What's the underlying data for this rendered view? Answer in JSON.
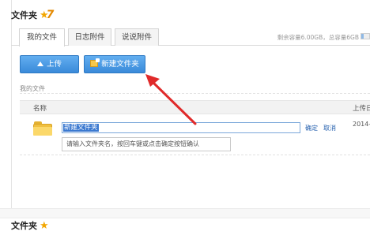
{
  "header": {
    "title": "文件夹",
    "badge_icon": "star-seven-icon"
  },
  "tabs": [
    {
      "label": "我的文件",
      "active": true
    },
    {
      "label": "日志附件",
      "active": false
    },
    {
      "label": "说说附件",
      "active": false
    }
  ],
  "quota": {
    "text": "剩余容量6.00GB，总容量6GB"
  },
  "toolbar": {
    "upload_label": "上传",
    "new_folder_label": "新建文件夹"
  },
  "breadcrumb": "我的文件",
  "table": {
    "col_name": "名称",
    "col_date": "上传日",
    "new_row": {
      "input_value": "新建文件夹",
      "confirm_label": "确定",
      "cancel_label": "取消",
      "date": "2014-"
    }
  },
  "tooltip": "请输入文件夹名，按回车键或点击确定按钮确认",
  "colors": {
    "accent": "#3a8ad9",
    "arrow": "#e02a2a",
    "folder": "#f0c040",
    "link": "#2a64b0"
  }
}
